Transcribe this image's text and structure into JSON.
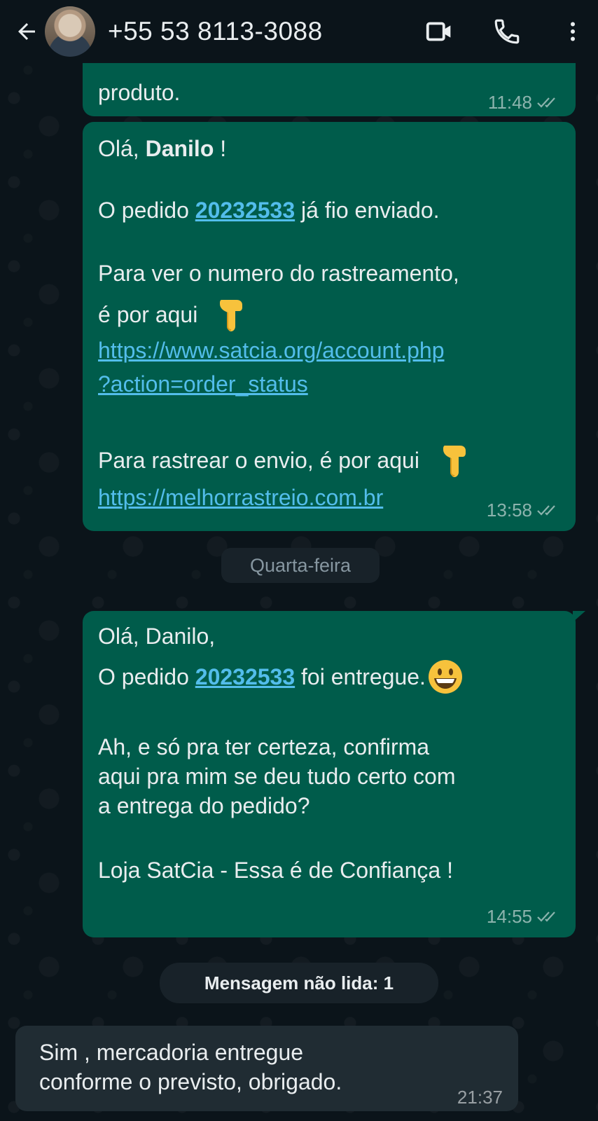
{
  "header": {
    "contact_name": "+55 53 8113-3088",
    "icons": [
      "back-arrow-icon",
      "video-call-icon",
      "phone-icon",
      "more-vert-icon"
    ]
  },
  "messages": [
    {
      "partial_text": "produto.",
      "time": "11:48"
    },
    {
      "greeting_prefix": "Olá, ",
      "greeting_name": "Danilo",
      "greeting_suffix": " !",
      "order_prefix": "O pedido ",
      "order_number": "20232533",
      "order_suffix": " já fio enviado.",
      "tracking_line1": "Para ver o numero do rastreamento,",
      "tracking_line2": "é por aqui",
      "link1_part1": "https://www.satcia.org/account.php",
      "link1_part2": "?action=order_status",
      "ship_line": "Para rastrear o envio, é por aqui",
      "link2": "https://melhorrastreio.com.br",
      "time": "13:58"
    },
    {
      "line1": "Olá, Danilo,",
      "order_prefix": "O pedido ",
      "order_number": "20232533",
      "order_suffix": " foi entregue.",
      "confirm_line1": "Ah, e só pra ter certeza, confirma",
      "confirm_line2": "aqui pra mim se deu tudo certo com",
      "confirm_line3": "a entrega do pedido?",
      "signature": "Loja SatCia - Essa é de Confiança !",
      "time": "14:55"
    },
    {
      "line1": "Sim ,  mercadoria entregue",
      "line2": "conforme o previsto, obrigado.",
      "time": "21:37"
    }
  ],
  "date_chip": "Quarta-feira",
  "unread_chip": "Mensagem não lida: 1",
  "colors": {
    "background": "#0b141a",
    "outgoing_bubble": "#005c4b",
    "incoming_bubble": "#202c33",
    "link": "#53bdeb"
  }
}
